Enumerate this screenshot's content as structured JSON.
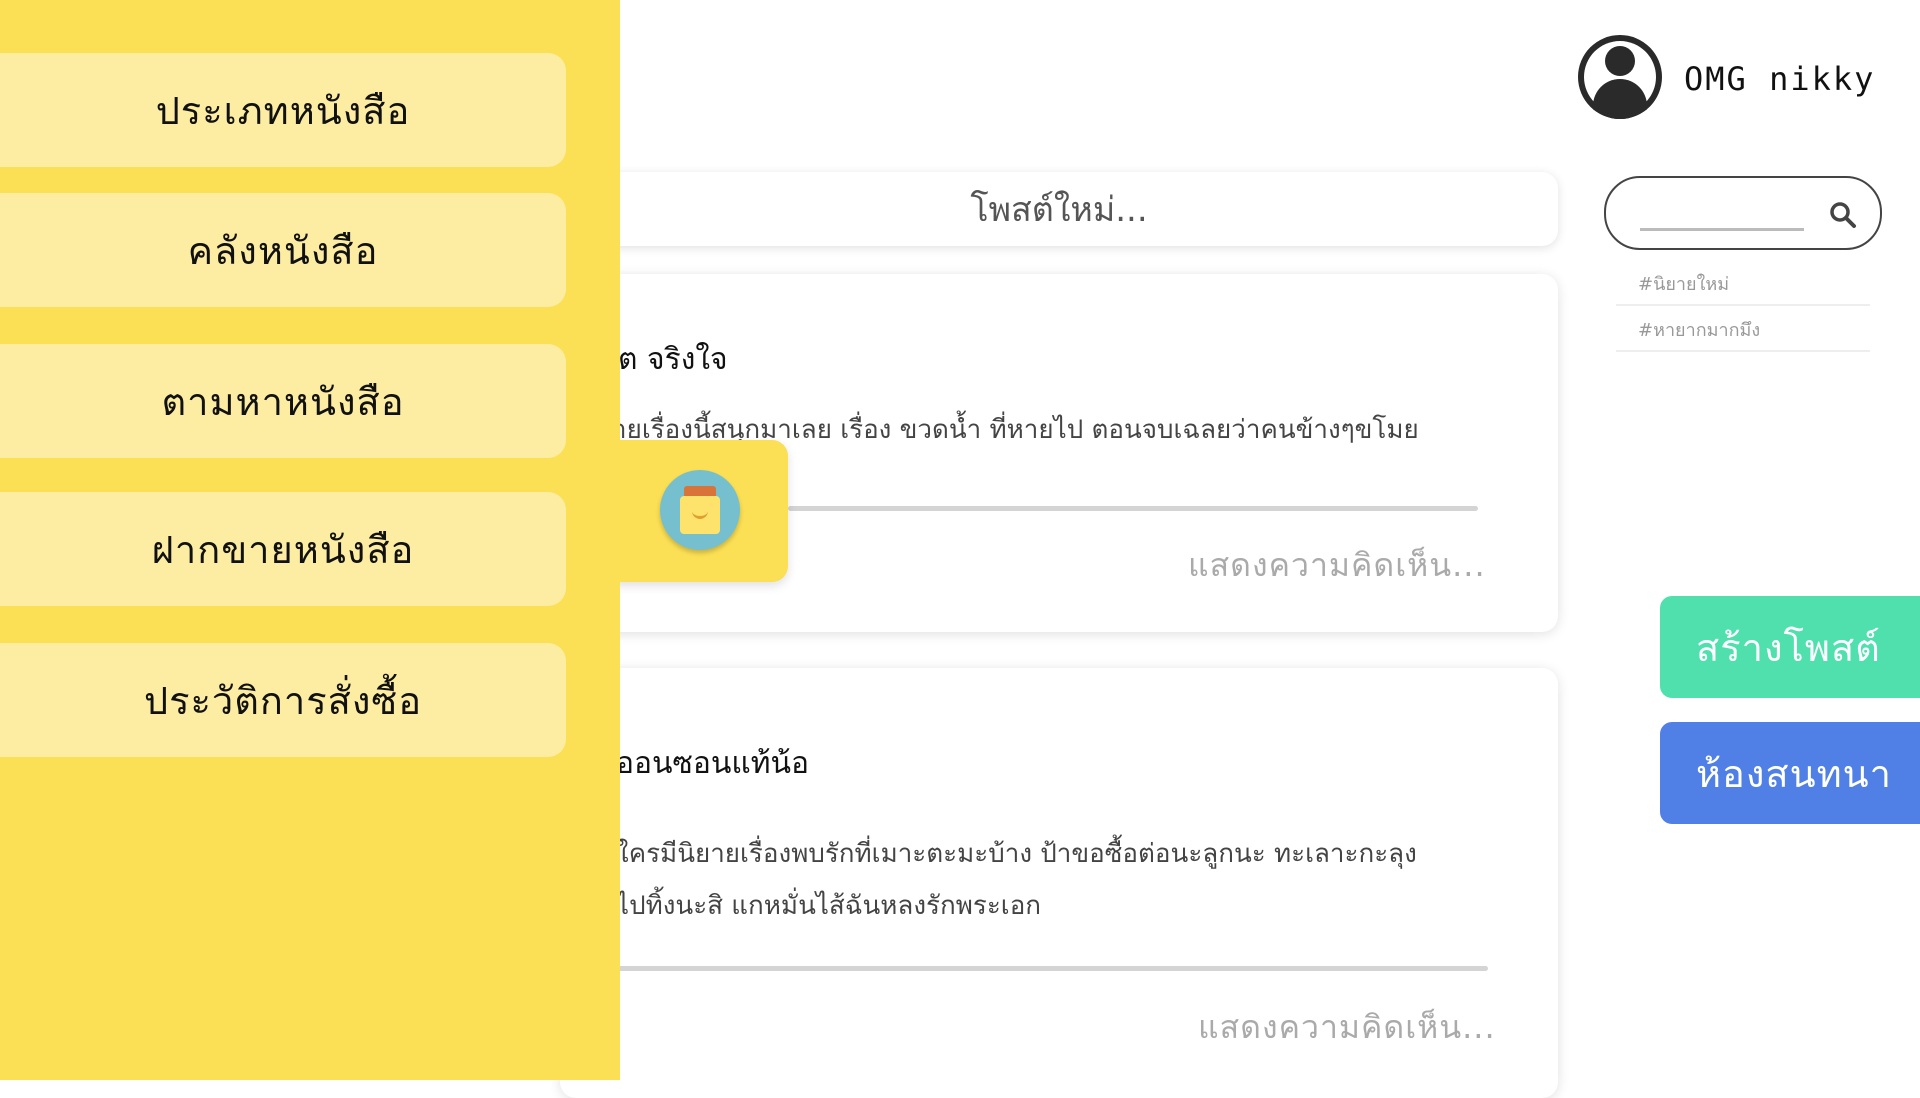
{
  "drawer": {
    "items": [
      {
        "label": "ประเภทหนังสือ"
      },
      {
        "label": "คลังหนังสือ"
      },
      {
        "label": "ตามหาหนังสือ"
      },
      {
        "label": "ฝากขายหนังสือ"
      },
      {
        "label": "ประวัติการสั่งซื้อ"
      }
    ],
    "tab_icon": "shopping-bag-icon"
  },
  "profile": {
    "username": "OMG nikky",
    "avatar_icon": "user-icon"
  },
  "search": {
    "value": "",
    "icon": "search-icon"
  },
  "tags": [
    "#นิยายใหม่",
    "#หายากมากมึง"
  ],
  "feed": {
    "new_post_placeholder": "โพสต์ใหม่...",
    "posts": [
      {
        "title": "ต จริงใจ",
        "body_lines": [
          "ายเรื่องนี้สนุกมาเลย เรื่อง ขวดน้ำ ที่หายไป ตอนจบเฉลยว่าคนข้างๆขโมย"
        ],
        "comment_placeholder": "แสดงความคิดเห็น..."
      },
      {
        "title": "ออนซอนแท้น้อ",
        "body_lines": [
          "ใครมีนิยายเรื่องพบรักที่เมาะตะมะบ้าง ป้าขอซื้อต่อนะลูกนะ ทะเลาะกะลุง",
          "ไปทิ้งนะสิ แกหมั่นไส้ฉันหลงรักพระเอก"
        ],
        "comment_placeholder": "แสดงความคิดเห็น..."
      }
    ]
  },
  "actions": {
    "create_post": "สร้างโพสต์",
    "chat_room": "ห้องสนทนา"
  },
  "colors": {
    "drawer_bg": "#fbdf54",
    "menu_item_bg": "#fdeda2",
    "create_post_bg": "#4fe0ae",
    "chat_room_bg": "#5080e6"
  }
}
